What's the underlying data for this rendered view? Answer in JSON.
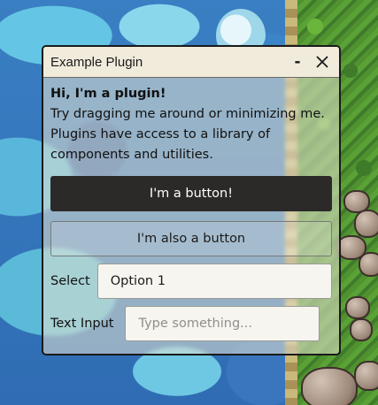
{
  "window": {
    "title": "Example Plugin",
    "minimize_symbol": "-",
    "close_symbol": "✕"
  },
  "content": {
    "heading": "Hi, I'm a plugin!",
    "description": "Try dragging me around or minimizing me. Plugins have access to a library of components and utilities.",
    "primary_button": "I'm a button!",
    "secondary_button": "I'm also a button",
    "select": {
      "label": "Select",
      "value": "Option 1"
    },
    "text_input": {
      "label": "Text Input",
      "value": "",
      "placeholder": "Type something..."
    }
  },
  "colors": {
    "titlebar_bg": "#f1ebdc",
    "primary_button_bg": "#2b2a28",
    "primary_button_text": "#ffffff"
  }
}
